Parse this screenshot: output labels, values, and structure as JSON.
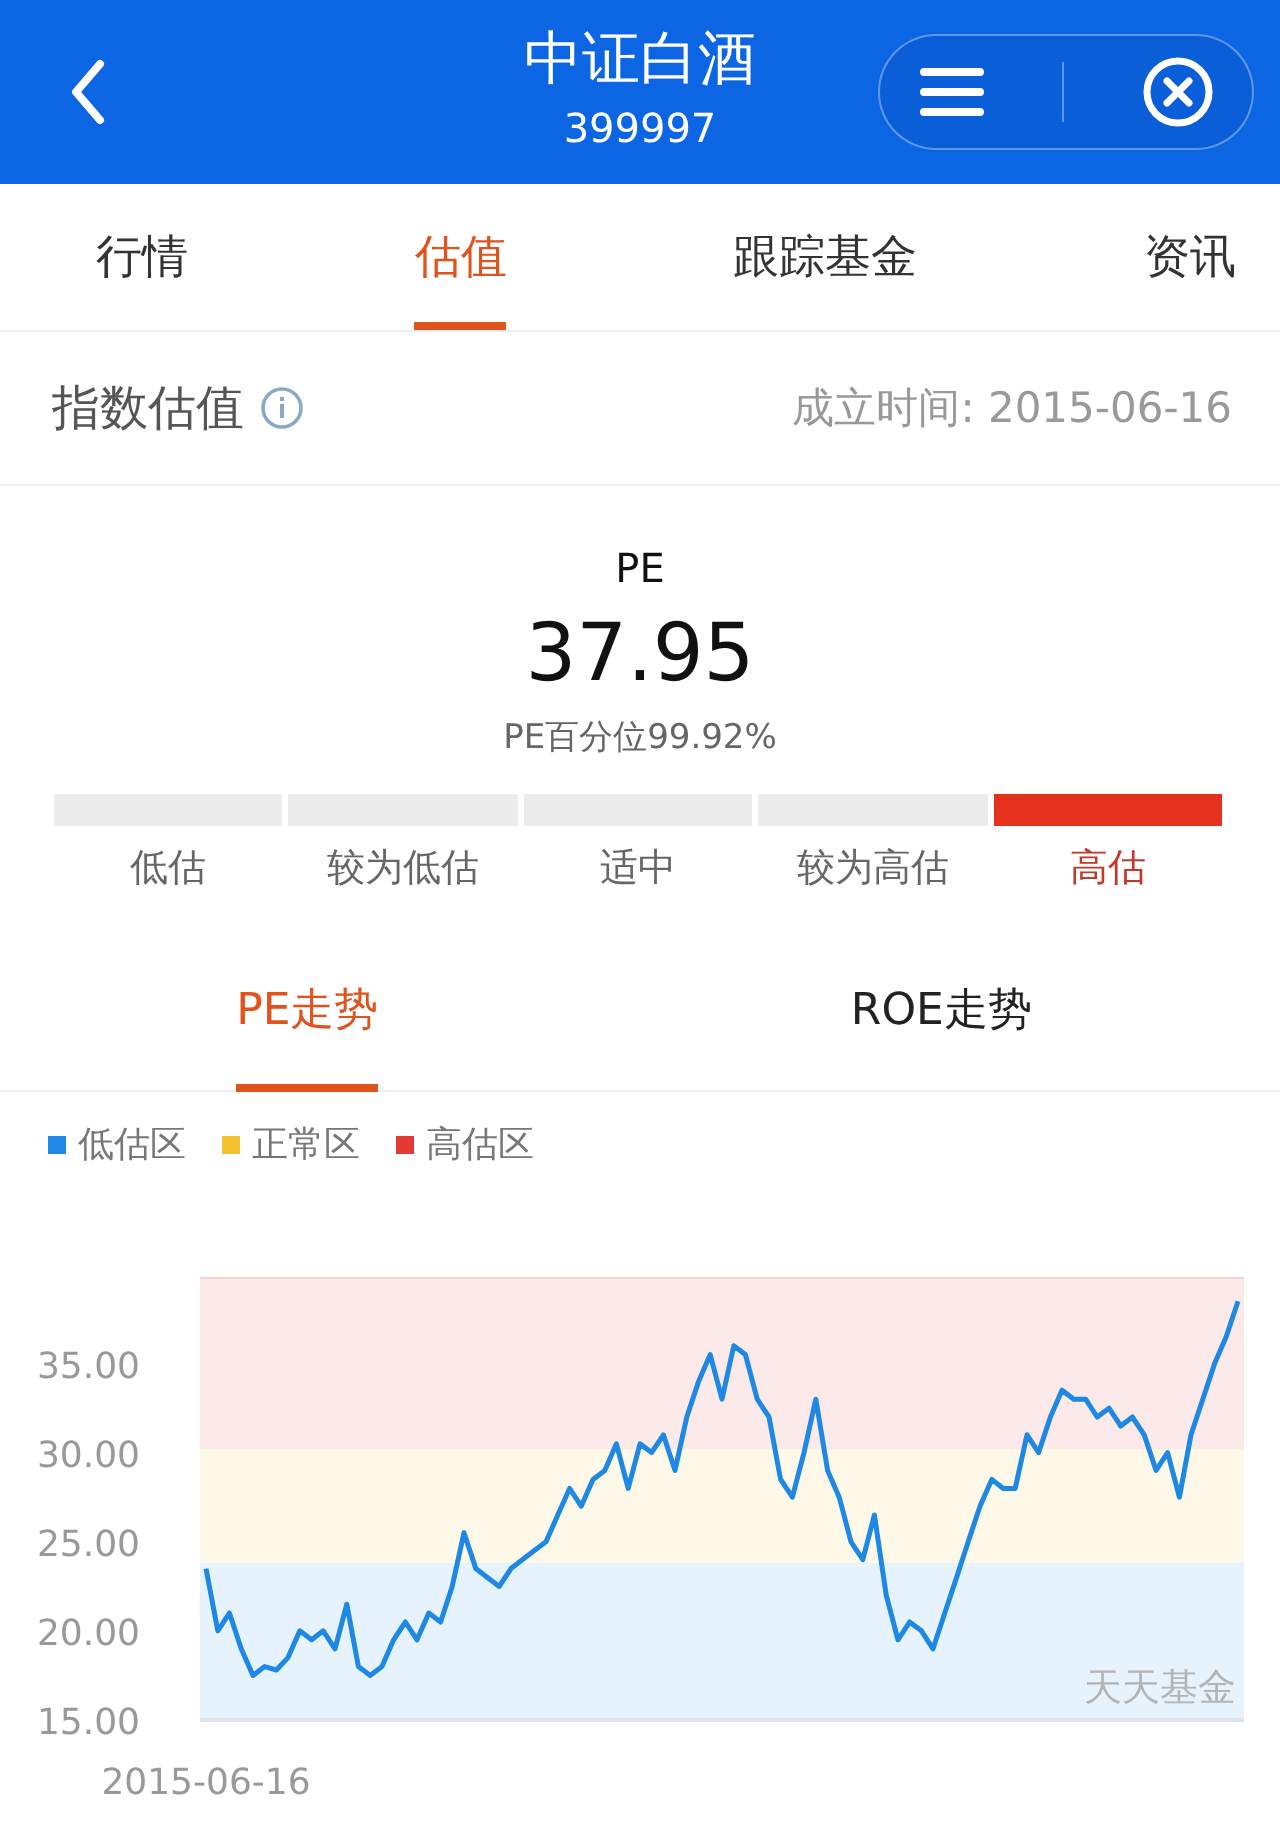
{
  "header": {
    "title": "中证白酒",
    "code": "399997"
  },
  "tabs": [
    {
      "label": "行情",
      "selected": false
    },
    {
      "label": "估值",
      "selected": true
    },
    {
      "label": "跟踪基金",
      "selected": false
    },
    {
      "label": "资讯",
      "selected": false
    }
  ],
  "section": {
    "title": "指数估值",
    "established": "成立时间: 2015-06-16"
  },
  "valuation": {
    "metric": "PE",
    "value": "37.95",
    "percentile": "PE百分位99.92%",
    "levels": [
      {
        "label": "低估",
        "selected": false
      },
      {
        "label": "较为低估",
        "selected": false
      },
      {
        "label": "适中",
        "selected": false
      },
      {
        "label": "较为高估",
        "selected": false
      },
      {
        "label": "高估",
        "selected": true
      }
    ]
  },
  "trend_tabs": [
    {
      "label": "PE走势",
      "selected": true
    },
    {
      "label": "ROE走势",
      "selected": false
    }
  ],
  "legend": [
    {
      "label": "低估区",
      "color": "#1e88e5"
    },
    {
      "label": "正常区",
      "color": "#f5c02e"
    },
    {
      "label": "高估区",
      "color": "#e53935"
    }
  ],
  "chart_watermark": "天天基金",
  "chart_start_date": "2015-06-16",
  "chart_data": {
    "type": "line",
    "ylim": [
      15,
      39.8
    ],
    "yticks": [
      {
        "value": 15,
        "label": "15.00"
      },
      {
        "value": 20,
        "label": "20.00"
      },
      {
        "value": 25,
        "label": "25.00"
      },
      {
        "value": 30,
        "label": "30.00"
      },
      {
        "value": 35,
        "label": "35.00"
      }
    ],
    "series": [
      {
        "color": "#1e88e5",
        "values": [
          23.5,
          20,
          21,
          19,
          17.5,
          18,
          17.8,
          18.5,
          20,
          19.5,
          20,
          19,
          21.5,
          18,
          17.5,
          18,
          19.5,
          20.5,
          19.5,
          21,
          20.5,
          22.5,
          25.5,
          23.5,
          23,
          22.5,
          23.5,
          24,
          24.5,
          25,
          26.5,
          28,
          27,
          28.5,
          29,
          30.5,
          28,
          30.5,
          30,
          31,
          29,
          32,
          34,
          35.5,
          33,
          36,
          35.5,
          33,
          32,
          28.5,
          27.5,
          30,
          33,
          29,
          27.5,
          25,
          24,
          26.5,
          22,
          19.5,
          20.5,
          20,
          19,
          21,
          23,
          25,
          27,
          28.5,
          28,
          28,
          31,
          30,
          32,
          33.5,
          33,
          33,
          32,
          32.5,
          31.5,
          32,
          31,
          29,
          30,
          27.5,
          31,
          33,
          35,
          36.5,
          38.5
        ]
      }
    ]
  }
}
